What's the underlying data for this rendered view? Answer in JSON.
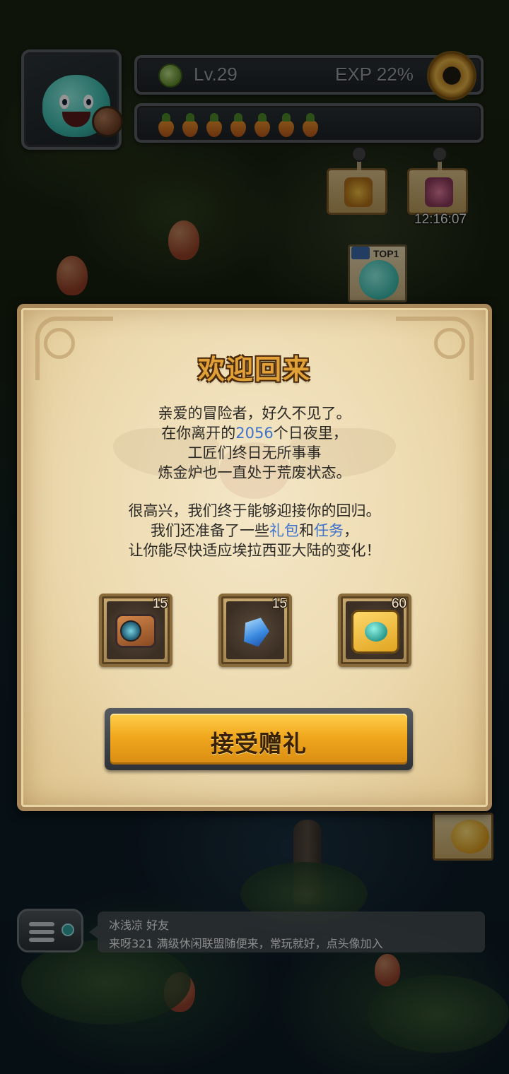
{
  "hud": {
    "level": "Lv.29",
    "exp": "EXP 22%",
    "carrot_count": 7,
    "timer": "12:16:07",
    "top_label": "TOP1"
  },
  "dialog": {
    "title": "欢迎回来",
    "line1": "亲爱的冒险者，好久不见了。",
    "line2_prefix": "在你离开的",
    "line2_days": "2056",
    "line2_suffix": "个日夜里，",
    "line3": "工匠们终日无所事事",
    "line4": "炼金炉也一直处于荒废状态。",
    "line5": "很高兴，我们终于能够迎接你的回归。",
    "line6_prefix": "我们还准备了一些",
    "line6_gift": "礼包",
    "line6_and": "和",
    "line6_task": "任务",
    "line6_suffix": "，",
    "line7": "让你能尽快适应埃拉西亚大陆的变化！",
    "rewards": [
      {
        "icon": "camera-icon",
        "count": "15"
      },
      {
        "icon": "crystal-icon",
        "count": "15"
      },
      {
        "icon": "puzzle-piece-icon",
        "count": "60"
      }
    ],
    "accept_label": "接受赠礼"
  },
  "chat": {
    "line1": "冰浅凉  好友",
    "line2": "来呀321  满级休闲联盟随便来，常玩就好，点头像加入"
  },
  "colors": {
    "title_orange": "#e2a137",
    "highlight_blue": "#3f72c9",
    "button_gold": "#f1a81e",
    "parchment": "#ecd9ae"
  }
}
